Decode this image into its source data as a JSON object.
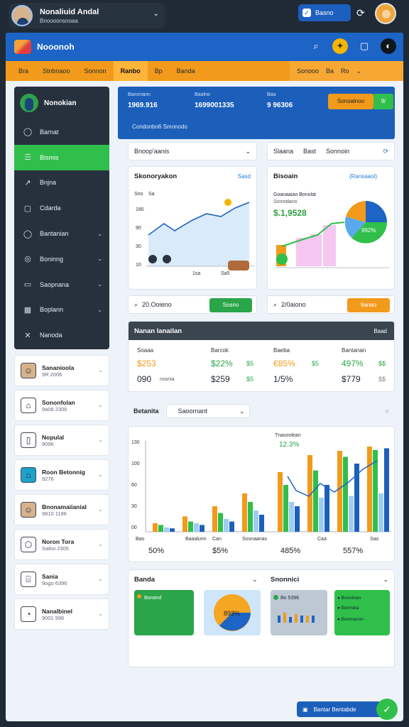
{
  "topbar": {
    "user_name": "Nonaliuid Andal",
    "user_sub": "Bnoooonsnoaa",
    "badge": "Basno",
    "caret": "⌄"
  },
  "app": {
    "name": "Nooonoh"
  },
  "nav": {
    "items": [
      "Bra",
      "Stnbnaoo",
      "Sonnon",
      "Ranbo",
      "Bp",
      "Banda"
    ],
    "active": 3,
    "right": [
      "Sonooo",
      "Ba",
      "Ro"
    ]
  },
  "sidebar": {
    "user": "Nonokian",
    "items": [
      {
        "label": "Barnat",
        "icon": "chat-icon",
        "caret": false
      },
      {
        "label": "Bismis",
        "icon": "menu-icon",
        "caret": false
      },
      {
        "label": "Bnjna",
        "icon": "chart-icon",
        "caret": false
      },
      {
        "label": "Cdarda",
        "icon": "calendar-icon",
        "caret": false
      },
      {
        "label": "Bantanian",
        "icon": "chat-icon",
        "caret": true
      },
      {
        "label": "Boninng",
        "icon": "settings-icon",
        "caret": true
      },
      {
        "label": "Saopnana",
        "icon": "message-icon",
        "caret": true
      },
      {
        "label": "Boplann",
        "icon": "grid-icon",
        "caret": true
      },
      {
        "label": "Nanoda",
        "icon": "tools-icon",
        "caret": false
      }
    ],
    "active": 1
  },
  "mini_cards": [
    {
      "title": "Sananioola",
      "sub": "9R 2006",
      "icon": "person-icon"
    },
    {
      "title": "Sononfolan",
      "sub": "9a06 2306",
      "icon": "store-icon"
    },
    {
      "title": "Nopulal",
      "sub": "9096",
      "icon": "door-icon"
    },
    {
      "title": "Roon Betonnig",
      "sub": "9276",
      "icon": "home-icon"
    },
    {
      "title": "Bnonamaiianial",
      "sub": "9810 1196",
      "icon": "person-icon"
    },
    {
      "title": "Noron Tora",
      "sub": "Sa6oi 2306",
      "icon": "shield-icon"
    },
    {
      "title": "Sania",
      "sub": "9ogo 6396",
      "icon": "bank-icon"
    },
    {
      "title": "Nanalbinel",
      "sub": "9001 996",
      "icon": "clock-icon"
    }
  ],
  "banner": {
    "cols": [
      {
        "label": "Banonann",
        "value": "1969.916"
      },
      {
        "label": "Baalno",
        "value": "1699001335"
      },
      {
        "label": "Baa",
        "value": "9 96306"
      }
    ],
    "button": "Sonoalnoo",
    "button2": "9/",
    "sub": "Condonbo6 Smonodo"
  },
  "selects": {
    "left": "Bnoop'aanis",
    "r1": "Slaana",
    "r2": "Bast",
    "r3": "Sonnoin"
  },
  "panel_a": {
    "title": "Skonoryakon",
    "link": "Sasd",
    "ylabel_top": "Sno",
    "ylabel_unit": "Sa",
    "yticks": [
      "180",
      "90",
      "30",
      "10"
    ],
    "xticks": [
      "1sa",
      "Sa5"
    ]
  },
  "panel_b": {
    "title": "Bisoain",
    "link": "(Ransaaol)",
    "label1": "Goanaaiao Bonolat",
    "label2": "Sonnidano",
    "value": "$.1,9528",
    "pie_label": "992%"
  },
  "action_a": {
    "label": "20.Ooieno",
    "button": "Sosno"
  },
  "action_b": {
    "label": "2/0aiono",
    "button": "9anao"
  },
  "table": {
    "title": "Nanan lanailan",
    "right": "Baad",
    "cols": [
      "Soaaa",
      "Barcok",
      "Baeba",
      "Bantanan"
    ],
    "row1": [
      "$253",
      "$22%",
      "$5",
      "€85%",
      "$5",
      "497%",
      "$$"
    ],
    "row2": [
      "090",
      "nosnia",
      "$259",
      "$5",
      "1/5%",
      "$779",
      "$$"
    ]
  },
  "filter": {
    "label": "Betanita",
    "select": "Saoornant",
    "caret": "⌄"
  },
  "chart_data": [
    {
      "type": "bar",
      "title": "",
      "annotation": "Tnasoolean",
      "annotation2": "12.3%",
      "yticks": [
        "130",
        "100",
        "60",
        "30",
        "00"
      ],
      "categories": [
        "a",
        "b",
        "c",
        "d",
        "e",
        "f",
        "g",
        "h"
      ],
      "series": [
        {
          "values": [
            10,
            18,
            30,
            45,
            70,
            90,
            95,
            100
          ],
          "color": "#f29a1b"
        },
        {
          "values": [
            8,
            12,
            22,
            35,
            55,
            72,
            88,
            96
          ],
          "color": "#2fbf4a"
        },
        {
          "values": [
            5,
            10,
            15,
            25,
            35,
            40,
            42,
            45
          ],
          "color": "#9fcdf2"
        },
        {
          "values": [
            4,
            8,
            12,
            20,
            30,
            55,
            80,
            98
          ],
          "color": "#1c5fba"
        }
      ],
      "xlabels": [
        "Bao",
        "Baaalunn",
        "Can",
        "Sosnaanas",
        "Caa",
        "Sao"
      ],
      "stats": [
        "50%",
        "$5%",
        "485%",
        "557%"
      ]
    }
  ],
  "bottom_left": {
    "title": "Banda",
    "green": "Bonand"
  },
  "bottom_right": {
    "title": "Snonnici",
    "pie": "893%",
    "label": "Bo 5396",
    "items": [
      "Bonstnan",
      "Borrneia",
      "Bonmacon"
    ]
  },
  "fab": {
    "label": "Bantar Bentabde"
  }
}
